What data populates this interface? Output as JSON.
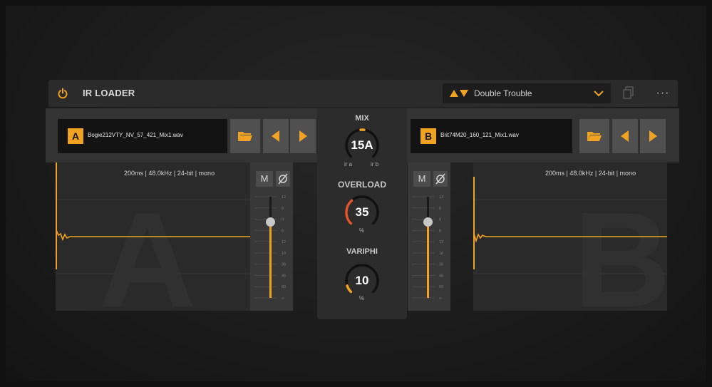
{
  "header": {
    "title": "IR LOADER",
    "preset_name": "Double Trouble",
    "more_label": "···"
  },
  "slot_a": {
    "letter": "A",
    "filename": "Bogie212VTY_NV_57_421_Mix1.wav",
    "info": "200ms | 48.0kHz | 24-bit | mono",
    "mute_label": "M",
    "watermark": "A",
    "scale": [
      "12",
      "6",
      "0",
      "6",
      "12",
      "18",
      "36",
      "45",
      "60",
      "∞"
    ]
  },
  "slot_b": {
    "letter": "B",
    "filename": "Brit74M20_160_121_Mix1.wav",
    "info": "200ms | 48.0kHz | 24-bit | mono",
    "mute_label": "M",
    "watermark": "B",
    "scale": [
      "12",
      "6",
      "0",
      "6",
      "12",
      "18",
      "36",
      "45",
      "60",
      "∞"
    ]
  },
  "mix": {
    "label": "MIX",
    "value": "15A",
    "left_label": "ir a",
    "right_label": "ir b"
  },
  "overload": {
    "label": "OVERLOAD",
    "value": "35",
    "unit": "%",
    "fraction": 0.35
  },
  "variphi": {
    "label": "VARIPHI",
    "value": "10",
    "unit": "%",
    "fraction": 0.1
  },
  "colors": {
    "accent": "#f0a322",
    "overload_accent": "#e2542a"
  }
}
